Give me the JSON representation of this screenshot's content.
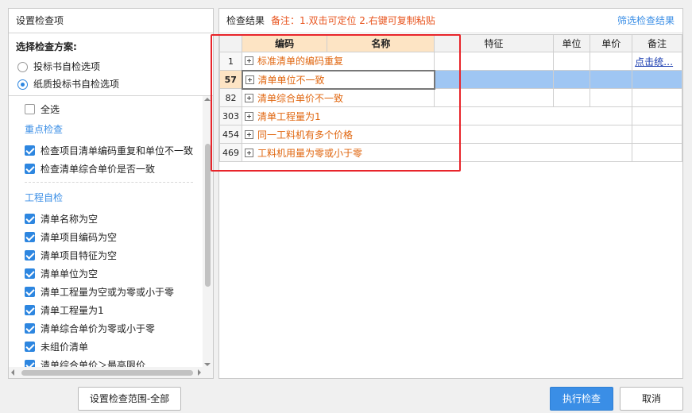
{
  "left_panel": {
    "title": "设置检查项",
    "scheme_label": "选择检查方案:",
    "schemes": [
      {
        "label": "投标书自检选项",
        "selected": false
      },
      {
        "label": "纸质投标书自检选项",
        "selected": true
      }
    ],
    "select_all": "全选",
    "groups": [
      {
        "title": "重点检查",
        "items": [
          "检查项目清单编码重复和单位不一致",
          "检查清单综合单价是否一致"
        ]
      },
      {
        "title": "工程自检",
        "items": [
          "清单名称为空",
          "清单项目编码为空",
          "清单项目特征为空",
          "清单单位为空",
          "清单工程量为空或为零或小于零",
          "清单工程量为1",
          "清单综合单价为零或小于零",
          "未组价清单",
          "清单综合单价＞最高限价"
        ]
      }
    ]
  },
  "right_panel": {
    "title": "检查结果",
    "note": "备注：1.双击可定位 2.右键可复制粘贴",
    "filter_link": "筛选检查结果",
    "columns": [
      "编码",
      "名称",
      "特征",
      "单位",
      "单价",
      "备注"
    ],
    "rows": [
      {
        "num": "1",
        "label": "标准清单的编码重复",
        "remark": "点击统…"
      },
      {
        "num": "57",
        "label": "清单单位不一致",
        "remark": ""
      },
      {
        "num": "82",
        "label": "清单综合单价不一致",
        "remark": ""
      },
      {
        "num": "303",
        "label": "清单工程量为1",
        "remark": ""
      },
      {
        "num": "454",
        "label": "同一工料机有多个价格",
        "remark": ""
      },
      {
        "num": "469",
        "label": "工料机用量为零或小于零",
        "remark": ""
      }
    ]
  },
  "buttons": {
    "set_range": "设置检查范围-全部",
    "execute": "执行检查",
    "cancel": "取消"
  },
  "colors": {
    "accent": "#3a8ee6",
    "note": "#e8541e",
    "highlight": "#e8252b"
  }
}
